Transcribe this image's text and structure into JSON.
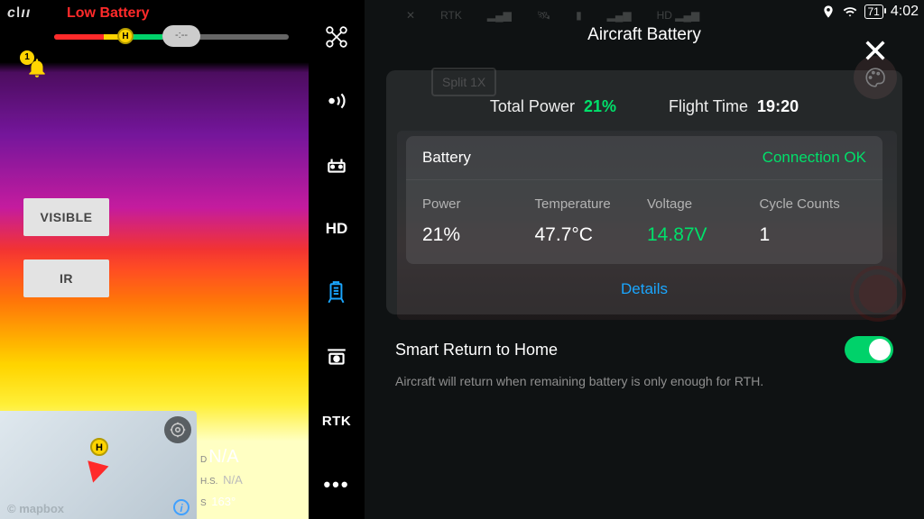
{
  "status_bar": {
    "battery_percent": "71",
    "clock": "4:02"
  },
  "warning": "Low Battery",
  "bell_badge": "1",
  "mode_buttons": {
    "visible": "VISIBLE",
    "ir": "IR"
  },
  "minimap": {
    "credit": "© mapbox",
    "h": "H"
  },
  "telemetry": {
    "d_label": "D",
    "d_val": "N/A",
    "hs_label": "H.S.",
    "hs_val": "N/A",
    "s_label": "S",
    "s_val": "163°"
  },
  "sidenav": {
    "hd": "HD",
    "rtk": "RTK"
  },
  "dim": {
    "split": "Split 1X",
    "rtk": "RTK"
  },
  "panel": {
    "title": "Aircraft Battery",
    "total_power_label": "Total Power",
    "total_power_value": "21%",
    "flight_time_label": "Flight Time",
    "flight_time_value": "19:20",
    "battery_heading": "Battery",
    "connection_status": "Connection OK",
    "cols": {
      "power_label": "Power",
      "power_value": "21%",
      "temp_label": "Temperature",
      "temp_value": "47.7°C",
      "volt_label": "Voltage",
      "volt_value": "14.87V",
      "cycles_label": "Cycle Counts",
      "cycles_value": "1"
    },
    "details_link": "Details",
    "smart_rth_title": "Smart Return to Home",
    "smart_rth_desc": "Aircraft will return when remaining battery is only enough for RTH."
  }
}
